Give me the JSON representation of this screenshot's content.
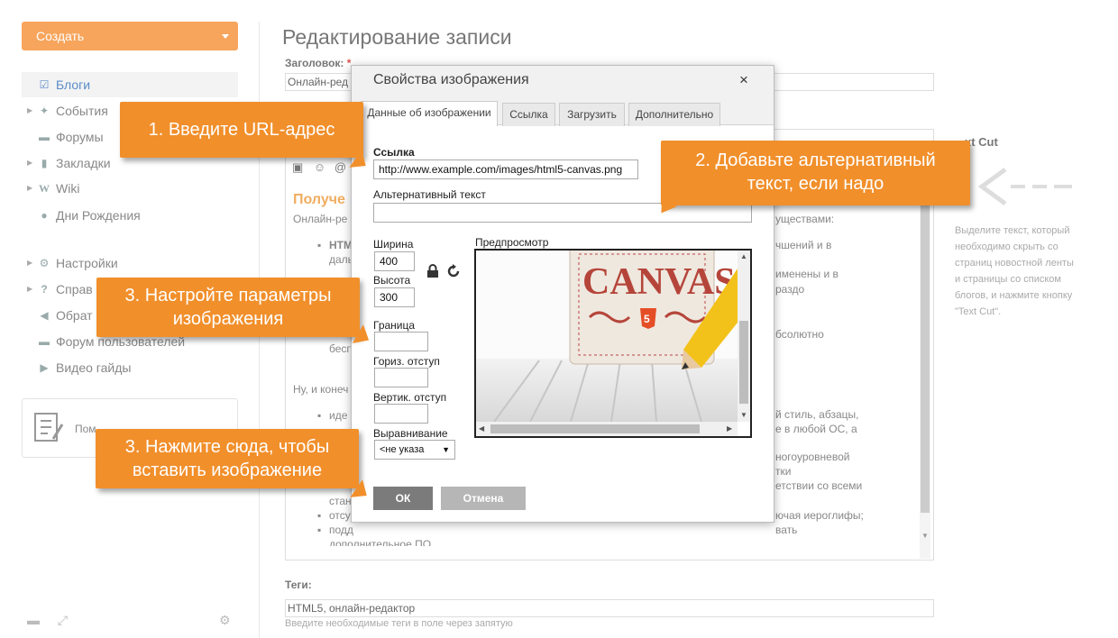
{
  "sidebar": {
    "create_label": "Создать",
    "items": [
      {
        "label": "Блоги",
        "icon": "edit-icon"
      },
      {
        "label": "События",
        "icon": "pin-icon"
      },
      {
        "label": "Форумы",
        "icon": "chat-icon"
      },
      {
        "label": "Закладки",
        "icon": "bookmark-icon"
      },
      {
        "label": "Wiki",
        "icon": "wiki-icon"
      },
      {
        "label": "Дни Рождения",
        "icon": "people-icon"
      },
      {
        "label": "Настройки",
        "icon": "gear-icon"
      },
      {
        "label": "Справ",
        "icon": "question-icon"
      },
      {
        "label": "Обрат",
        "icon": "megaphone-icon"
      },
      {
        "label": "Форум пользователей",
        "icon": "chat-icon"
      },
      {
        "label": "Видео гайды",
        "icon": "video-icon"
      }
    ],
    "helper_label": "Пом"
  },
  "main": {
    "title": "Редактирование записи",
    "title_field_label": "Заголовок:",
    "title_required": "*",
    "title_value": "Онлайн-ред",
    "editor": {
      "heading": "Получе",
      "lines_left": [
        "Онлайн-ре",
        "HTM",
        "даль",
        "бесп",
        "Ну, и конеч",
        "иде",
        "стан",
        "отсу",
        "подд",
        "дополнительное ПО."
      ],
      "lines_right": [
        "уществами:",
        "чшений и в",
        "именены и в",
        "раздо",
        "бсолютно",
        "й стиль, абзацы,",
        "е в любой ОС, а",
        "ногоуровневой",
        "тки",
        "етствии со всеми",
        "ючая иероглифы;",
        "вать"
      ]
    },
    "tags_label": "Теги:",
    "tags_value": "HTML5, онлайн-редактор",
    "tags_hint": "Введите необходимые теги в поле через запятую"
  },
  "right_side": {
    "title": "xt Cut",
    "text": "Выделите текст, который необходимо скрыть со страниц новостной ленты и страницы со списком блогов, и нажмите кнопку \"Text Cut\"."
  },
  "dialog": {
    "title": "Свойства изображения",
    "close": "×",
    "tabs": [
      "Данные об изображении",
      "Ссылка",
      "Загрузить",
      "Дополнительно"
    ],
    "url_label": "Ссылка",
    "url_value": "http://www.example.com/images/html5-canvas.png",
    "alt_label": "Альтернативный текст",
    "alt_value": "",
    "width_label": "Ширина",
    "width_value": "400",
    "height_label": "Высота",
    "height_value": "300",
    "border_label": "Граница",
    "hspace_label": "Гориз. отступ",
    "vspace_label": "Вертик. отступ",
    "align_label": "Выравнивание",
    "align_value": "<не указа",
    "preview_label": "Предпросмотр",
    "preview_image_text": "CANVAS",
    "preview_badge": "5",
    "ok_label": "ОК",
    "cancel_label": "Отмена"
  },
  "callouts": {
    "c1": "1. Введите URL-адрес",
    "c2_l1": "2. Добавьте альтернативный",
    "c2_l2": "текст, если надо",
    "c3_l1": "3. Настройте параметры",
    "c3_l2": "изображения",
    "c4_l1": "3. Нажмите сюда, чтобы",
    "c4_l2": "вставить изображение"
  },
  "colors": {
    "accent": "#f18f2b",
    "create": "#f7a55c",
    "link": "#5a8dc8"
  }
}
